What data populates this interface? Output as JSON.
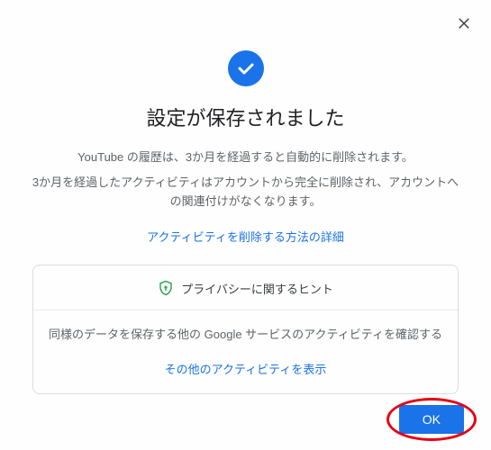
{
  "dialog": {
    "title": "設定が保存されました",
    "desc1": "YouTube の履歴は、3か月を経過すると自動的に削除されます。",
    "desc2": "3か月を経過したアクティビティはアカウントから完全に削除され、アカウントへの関連付けがなくなります。",
    "learn_more": "アクティビティを削除する方法の詳細"
  },
  "card": {
    "header": "プライバシーに関するヒント",
    "body": "同様のデータを保存する他の Google サービスのアクティビティを確認する",
    "link": "その他のアクティビティを表示"
  },
  "footer": {
    "ok": "OK"
  },
  "icons": {
    "close": "close-icon",
    "check": "checkmark-icon",
    "shield": "shield-icon"
  },
  "colors": {
    "accent": "#1a73e8",
    "highlight_ring": "#e60012",
    "shield": "#34a853"
  }
}
